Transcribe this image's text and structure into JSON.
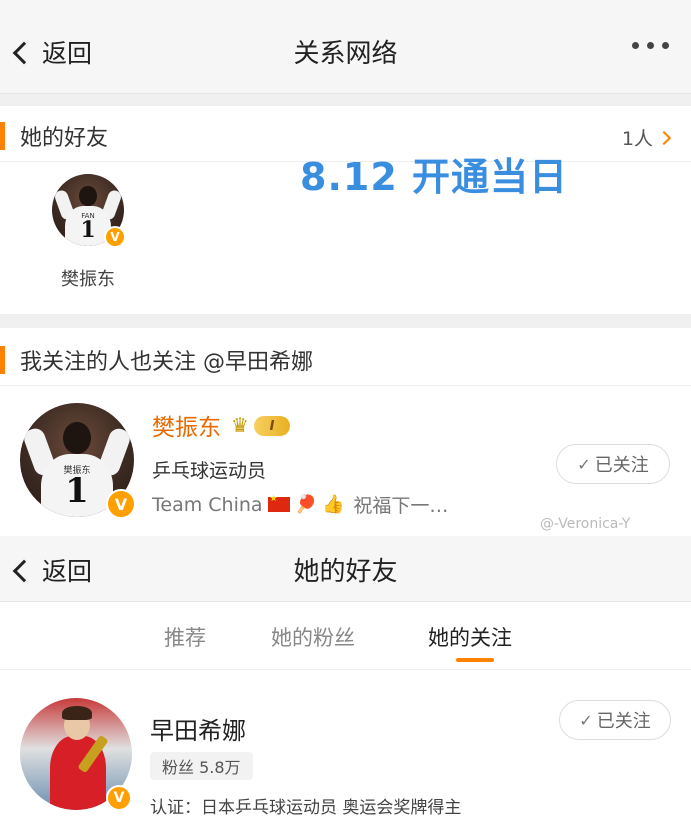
{
  "top": {
    "back_label": "返回",
    "title": "关系网络"
  },
  "friends_section": {
    "title": "她的好友",
    "count": "1人",
    "annotation": "8.12 开通当日",
    "friend": {
      "name": "樊振东",
      "jersey_number": "1",
      "jersey_name": "FAN"
    }
  },
  "common_section": {
    "title": "我关注的人也关注 @早田希娜",
    "user": {
      "name": "樊振东",
      "level": "I",
      "description": "乒乓球运动员",
      "bio_text": "Team China",
      "bio_tail": "祝福下一…",
      "follow_label": "已关注"
    }
  },
  "watermark": "@-Veronica-Y",
  "second": {
    "back_label": "返回",
    "title": "她的好友",
    "tabs": [
      {
        "label": "推荐"
      },
      {
        "label": "她的粉丝"
      },
      {
        "label": "她的关注"
      }
    ],
    "active_tab": "她的关注",
    "user": {
      "name": "早田希娜",
      "fans": "粉丝 5.8万",
      "verify": "认证：日本乒乓球运动员 奥运会奖牌得主",
      "follow_label": "已关注"
    }
  },
  "colors": {
    "accent": "#ff8200",
    "annotation": "#3a8ee0",
    "verified": "#ff9f00"
  },
  "icons": [
    "back-chevron-icon",
    "more-icon",
    "chevron-right-icon",
    "verified-badge-icon",
    "crown-icon",
    "check-icon",
    "china-flag-icon",
    "ping-pong-icon",
    "thumbs-up-icon"
  ]
}
